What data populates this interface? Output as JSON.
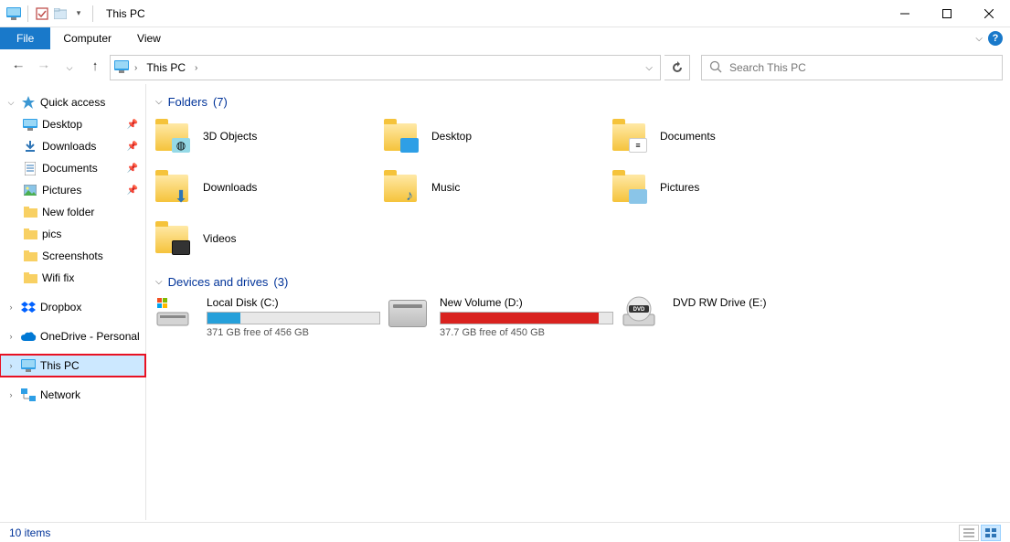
{
  "window": {
    "title": "This PC"
  },
  "menu": {
    "file": "File",
    "computer": "Computer",
    "view": "View"
  },
  "address": {
    "location": "This PC"
  },
  "search": {
    "placeholder": "Search This PC"
  },
  "sidebar": {
    "quick_access": "Quick access",
    "items": [
      {
        "label": "Desktop",
        "pinned": true
      },
      {
        "label": "Downloads",
        "pinned": true
      },
      {
        "label": "Documents",
        "pinned": true
      },
      {
        "label": "Pictures",
        "pinned": true
      },
      {
        "label": "New folder",
        "pinned": false
      },
      {
        "label": "pics",
        "pinned": false
      },
      {
        "label": "Screenshots",
        "pinned": false
      },
      {
        "label": "Wifi fix",
        "pinned": false
      }
    ],
    "dropbox": "Dropbox",
    "onedrive": "OneDrive - Personal",
    "this_pc": "This PC",
    "network": "Network"
  },
  "groups": {
    "folders": {
      "title": "Folders",
      "count": "(7)",
      "items": [
        "3D Objects",
        "Desktop",
        "Documents",
        "Downloads",
        "Music",
        "Pictures",
        "Videos"
      ]
    },
    "drives": {
      "title": "Devices and drives",
      "count": "(3)",
      "items": [
        {
          "name": "Local Disk (C:)",
          "free": "371 GB free of 456 GB",
          "fill_pct": 19,
          "color": "#26a0da"
        },
        {
          "name": "New Volume (D:)",
          "free": "37.7 GB free of 450 GB",
          "fill_pct": 92,
          "color": "#d9221f"
        },
        {
          "name": "DVD RW Drive (E:)",
          "free": "",
          "fill_pct": -1,
          "color": ""
        }
      ]
    }
  },
  "status": {
    "count": "10 items"
  }
}
